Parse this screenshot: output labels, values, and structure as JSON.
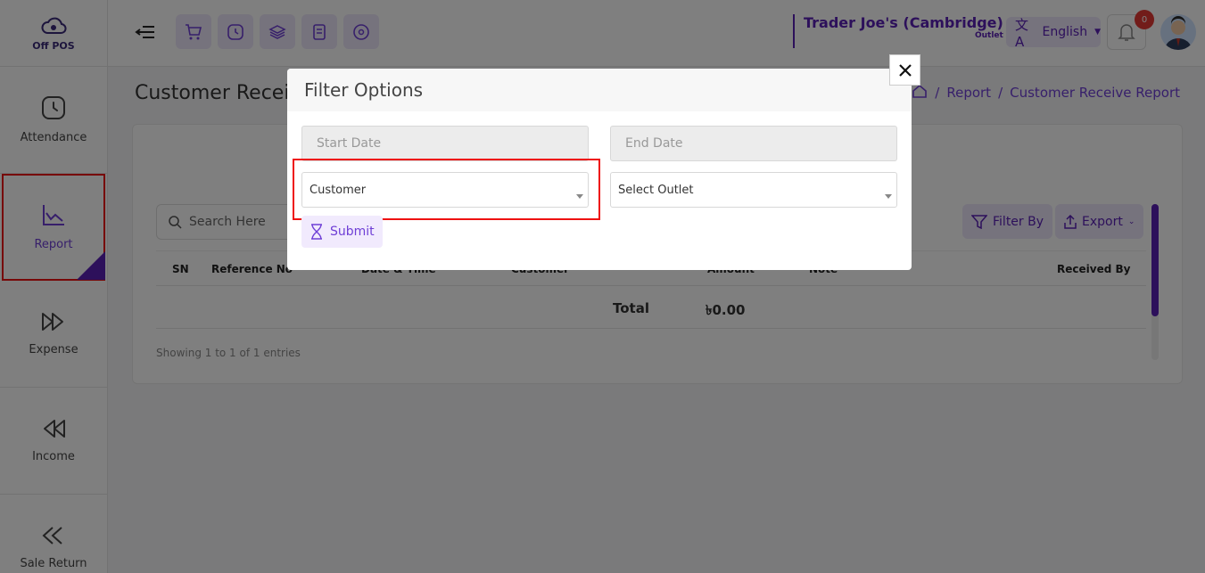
{
  "app": {
    "logo_text": "Off POS"
  },
  "sidebar": {
    "items": [
      {
        "label": "Attendance",
        "icon": "clock-icon"
      },
      {
        "label": "Report",
        "icon": "chart-icon"
      },
      {
        "label": "Expense",
        "icon": "expense-icon"
      },
      {
        "label": "Income",
        "icon": "income-icon"
      },
      {
        "label": "Sale Return",
        "icon": "return-icon"
      }
    ]
  },
  "topbar": {
    "outlet_name": "Trader Joe's (Cambridge)",
    "outlet_sub": "Outlet",
    "language": "English",
    "notification_count": "0"
  },
  "page": {
    "title": "Customer Receive Report",
    "breadcrumb": [
      "Report",
      "Customer Receive Report"
    ],
    "search_placeholder": "Search Here",
    "filter_label": "Filter By",
    "export_label": "Export",
    "columns": [
      "SN",
      "Reference No",
      "Date & Time",
      "Customer",
      "Amount",
      "Note",
      "Received By"
    ],
    "total_label": "Total",
    "total_value": "৳0.00",
    "showing": "Showing 1 to 1 of 1 entries"
  },
  "modal": {
    "title": "Filter Options",
    "start_date_placeholder": "Start Date",
    "end_date_placeholder": "End Date",
    "customer_value": "Customer",
    "outlet_value": "Select Outlet",
    "submit_label": "Submit"
  }
}
